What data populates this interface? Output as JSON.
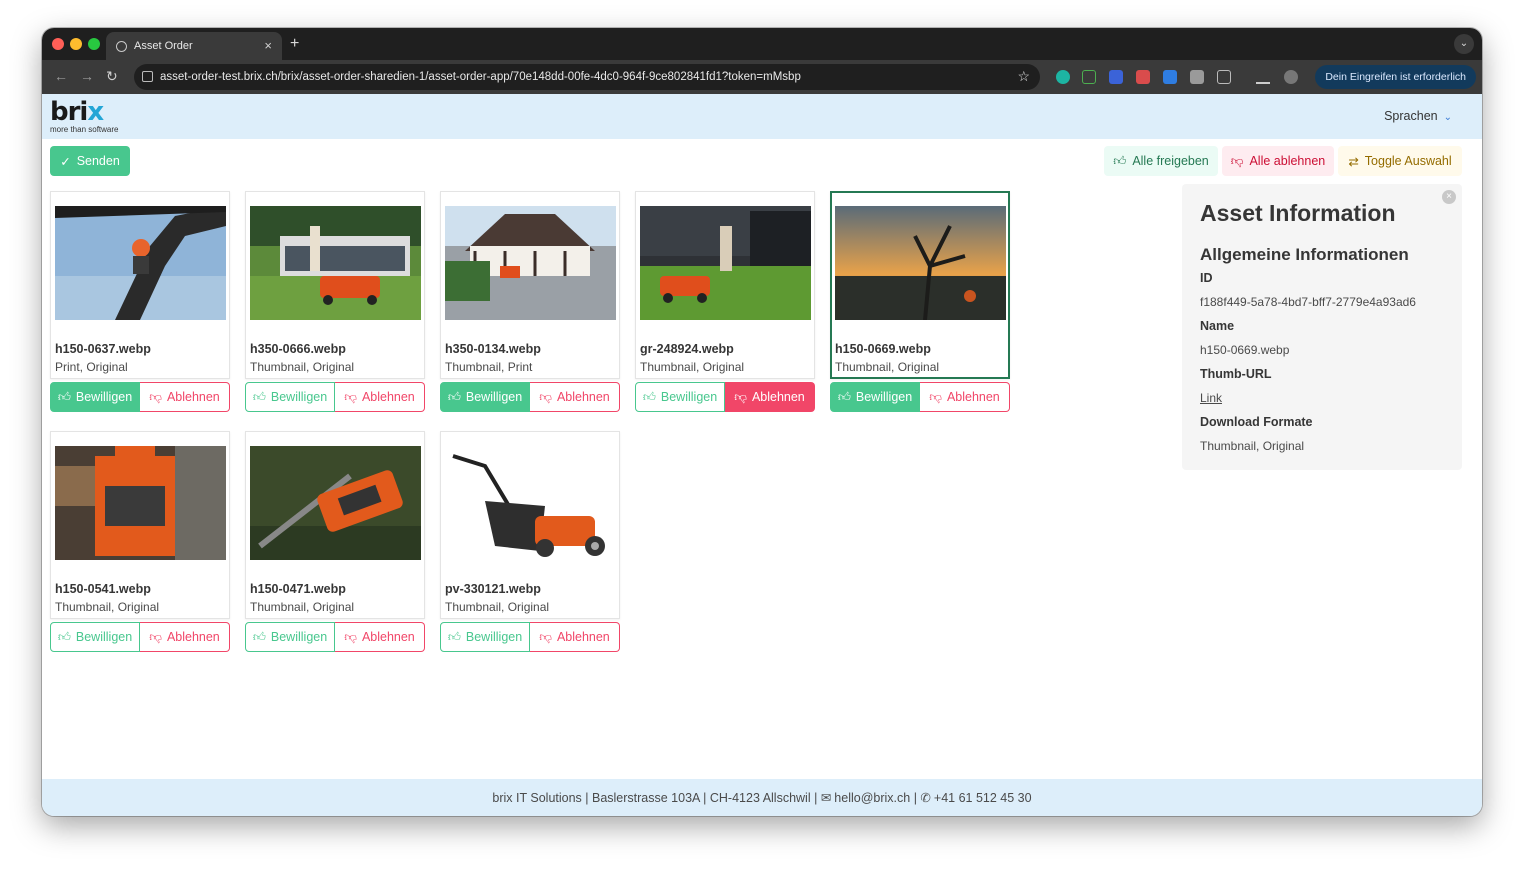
{
  "browser": {
    "tab_title": "Asset Order",
    "url": "asset-order-test.brix.ch/brix/asset-order-sharedien-1/asset-order-app/70e148dd-00fe-4dc0-964f-9ce802841fd1?token=mMsbp",
    "profile_label": "Dein Eingreifen ist erforderlich"
  },
  "header": {
    "logo_text": "brix",
    "logo_tagline": "more than software",
    "language_label": "Sprachen"
  },
  "actions": {
    "send_label": "Senden",
    "approve_all_label": "Alle freigeben",
    "reject_all_label": "Alle ablehnen",
    "toggle_label": "Toggle Auswahl"
  },
  "assets": [
    {
      "name": "h150-0637.webp",
      "formats": "Print, Original",
      "approve": "Bewilligen",
      "reject": "Ablehnen",
      "state": "approved"
    },
    {
      "name": "h350-0666.webp",
      "formats": "Thumbnail, Original",
      "approve": "Bewilligen",
      "reject": "Ablehnen",
      "state": "none"
    },
    {
      "name": "h350-0134.webp",
      "formats": "Thumbnail, Print",
      "approve": "Bewilligen",
      "reject": "Ablehnen",
      "state": "approved"
    },
    {
      "name": "gr-248924.webp",
      "formats": "Thumbnail, Original",
      "approve": "Bewilligen",
      "reject": "Ablehnen",
      "state": "rejected"
    },
    {
      "name": "h150-0669.webp",
      "formats": "Thumbnail, Original",
      "approve": "Bewilligen",
      "reject": "Ablehnen",
      "state": "approved"
    },
    {
      "name": "h150-0541.webp",
      "formats": "Thumbnail, Original",
      "approve": "Bewilligen",
      "reject": "Ablehnen",
      "state": "none"
    },
    {
      "name": "h150-0471.webp",
      "formats": "Thumbnail, Original",
      "approve": "Bewilligen",
      "reject": "Ablehnen",
      "state": "none"
    },
    {
      "name": "pv-330121.webp",
      "formats": "Thumbnail, Original",
      "approve": "Bewilligen",
      "reject": "Ablehnen",
      "state": "none"
    }
  ],
  "info": {
    "title": "Asset Information",
    "section": "Allgemeine Informationen",
    "id_label": "ID",
    "id_value": "f188f449-5a78-4bd7-bff7-2779e4a93ad6",
    "name_label": "Name",
    "name_value": "h150-0669.webp",
    "thumb_label": "Thumb-URL",
    "thumb_value": "Link",
    "formats_label": "Download Formate",
    "formats_value": "Thumbnail, Original"
  },
  "footer": {
    "text_1": "brix IT Solutions | Baslerstrasse 103A | CH-4123 Allschwil | ",
    "email": "hello@brix.ch",
    "text_2": " | ",
    "phone": "+41 61 512 45 30"
  },
  "colors": {
    "success": "#48c78e",
    "danger": "#f14668",
    "header_bg": "#ddeefa"
  }
}
